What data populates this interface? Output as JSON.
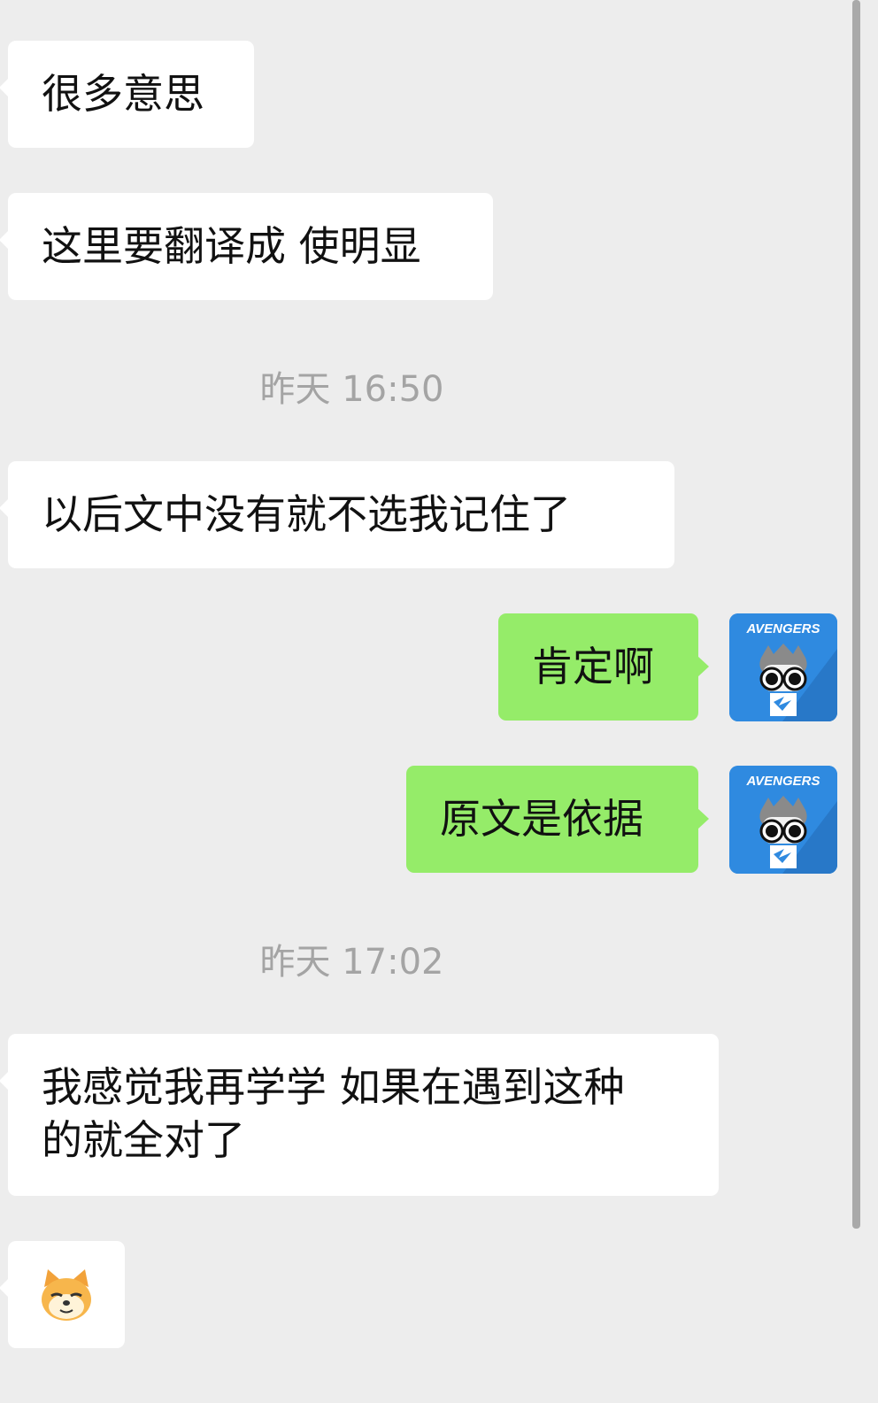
{
  "messages": [
    {
      "side": "received",
      "text": "很多意思"
    },
    {
      "side": "received",
      "text": "这里要翻译成 使明显"
    },
    {
      "timestamp": "昨天 16:50"
    },
    {
      "side": "received",
      "text": "以后文中没有就不选我记住了"
    },
    {
      "side": "sent",
      "text": "肯定啊",
      "avatar": "avengers-avatar"
    },
    {
      "side": "sent",
      "text": "原文是依据",
      "avatar": "avengers-avatar"
    },
    {
      "timestamp": "昨天 17:02"
    },
    {
      "side": "received",
      "lines": [
        "我感觉我再学学 如果在遇到这种",
        "的就全对了"
      ]
    },
    {
      "side": "received",
      "emoji": "doge-emoji"
    }
  ],
  "avatar_text": "AVENGERS",
  "colors": {
    "background": "#ededed",
    "received_bubble": "#ffffff",
    "sent_bubble": "#95ec69",
    "timestamp": "#a4a4a4",
    "avatar_bg": "#2f8ae0"
  }
}
